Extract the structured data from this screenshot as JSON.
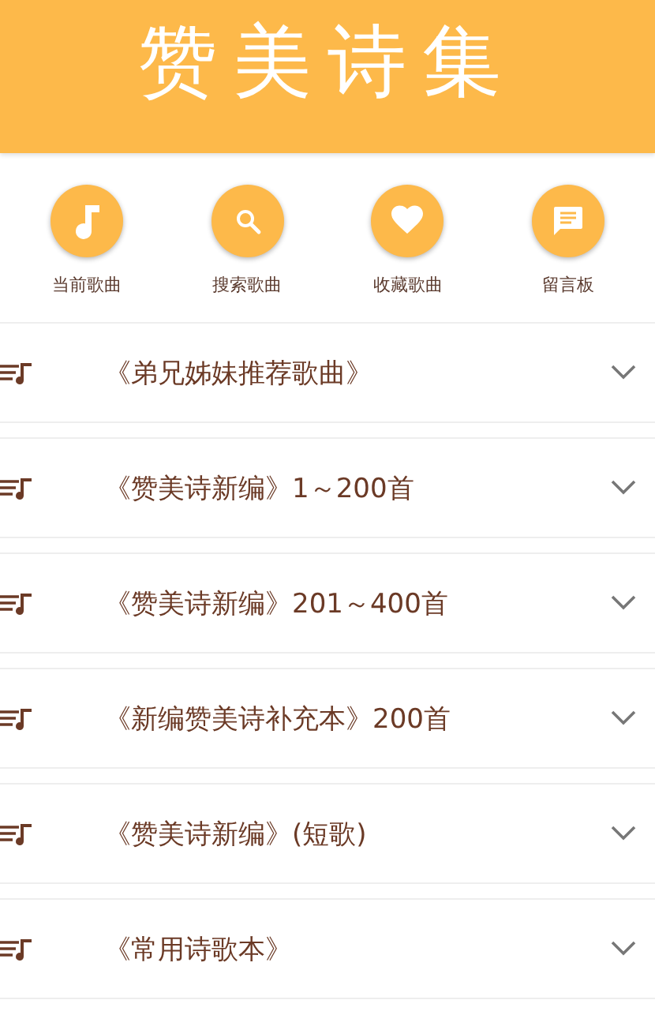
{
  "header": {
    "title": "赞美诗集"
  },
  "nav": [
    {
      "kind": "music",
      "label": "当前歌曲"
    },
    {
      "kind": "search",
      "label": "搜索歌曲"
    },
    {
      "kind": "heart",
      "label": "收藏歌曲"
    },
    {
      "kind": "message",
      "label": "留言板"
    }
  ],
  "songbooks": [
    {
      "title": "《弟兄姊妹推荐歌曲》",
      "expanded": false
    },
    {
      "title": "《赞美诗新编》1～200首",
      "expanded": false
    },
    {
      "title": "《赞美诗新编》201～400首",
      "expanded": false
    },
    {
      "title": "《新编赞美诗补充本》200首",
      "expanded": false
    },
    {
      "title": "《赞美诗新编》(短歌)",
      "expanded": false
    },
    {
      "title": "《常用诗歌本》",
      "expanded": false
    }
  ]
}
